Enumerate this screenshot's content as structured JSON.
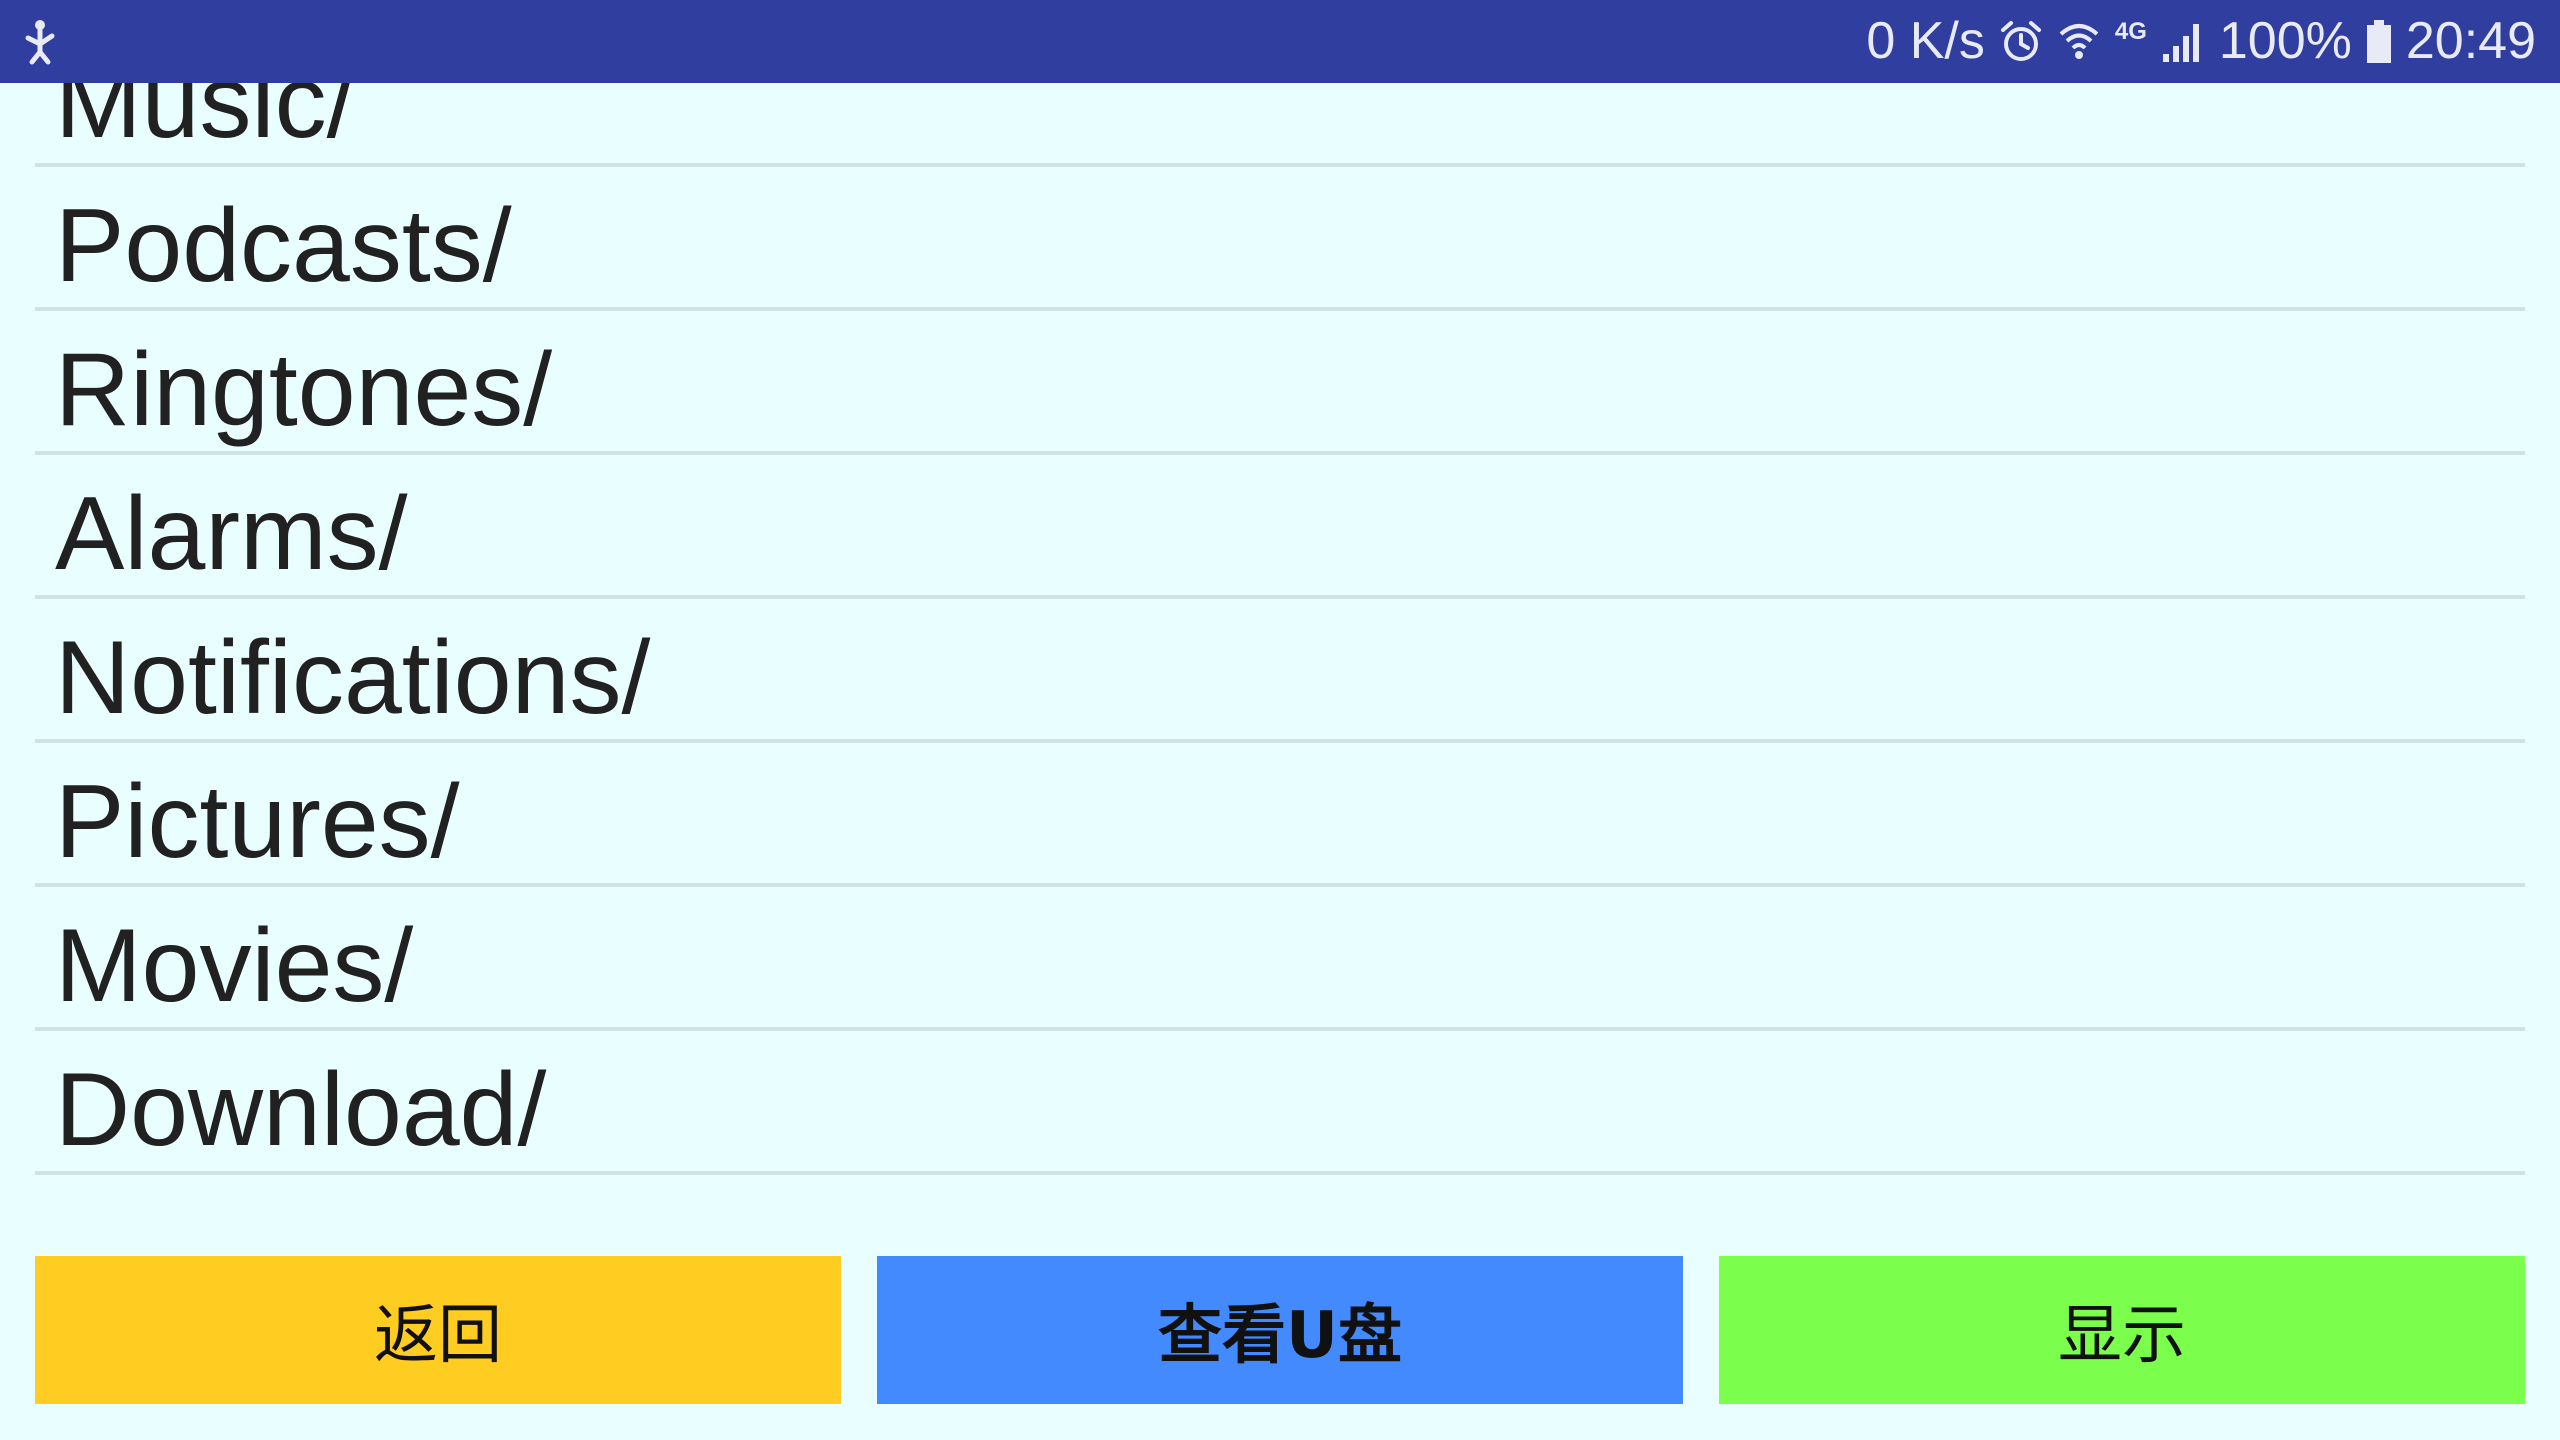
{
  "status_bar": {
    "net_speed": "0 K/s",
    "network_type": "4G",
    "battery": "100%",
    "time": "20:49",
    "icons": [
      "usb-debug-icon",
      "alarm-icon",
      "wifi-icon",
      "signal-icon",
      "battery-icon"
    ]
  },
  "file_list": {
    "items": [
      {
        "label": "Music/"
      },
      {
        "label": "Podcasts/"
      },
      {
        "label": "Ringtones/"
      },
      {
        "label": "Alarms/"
      },
      {
        "label": "Notifications/"
      },
      {
        "label": "Pictures/"
      },
      {
        "label": "Movies/"
      },
      {
        "label": "Download/"
      }
    ]
  },
  "buttons": {
    "back": "返回",
    "view_usb": "查看U盘",
    "show": "显示"
  },
  "colors": {
    "status_bar": "#303F9F",
    "background": "#E9FFFF",
    "back_button": "#FFCC22",
    "usb_button": "#448AFF",
    "show_button": "#7CFF4C"
  }
}
